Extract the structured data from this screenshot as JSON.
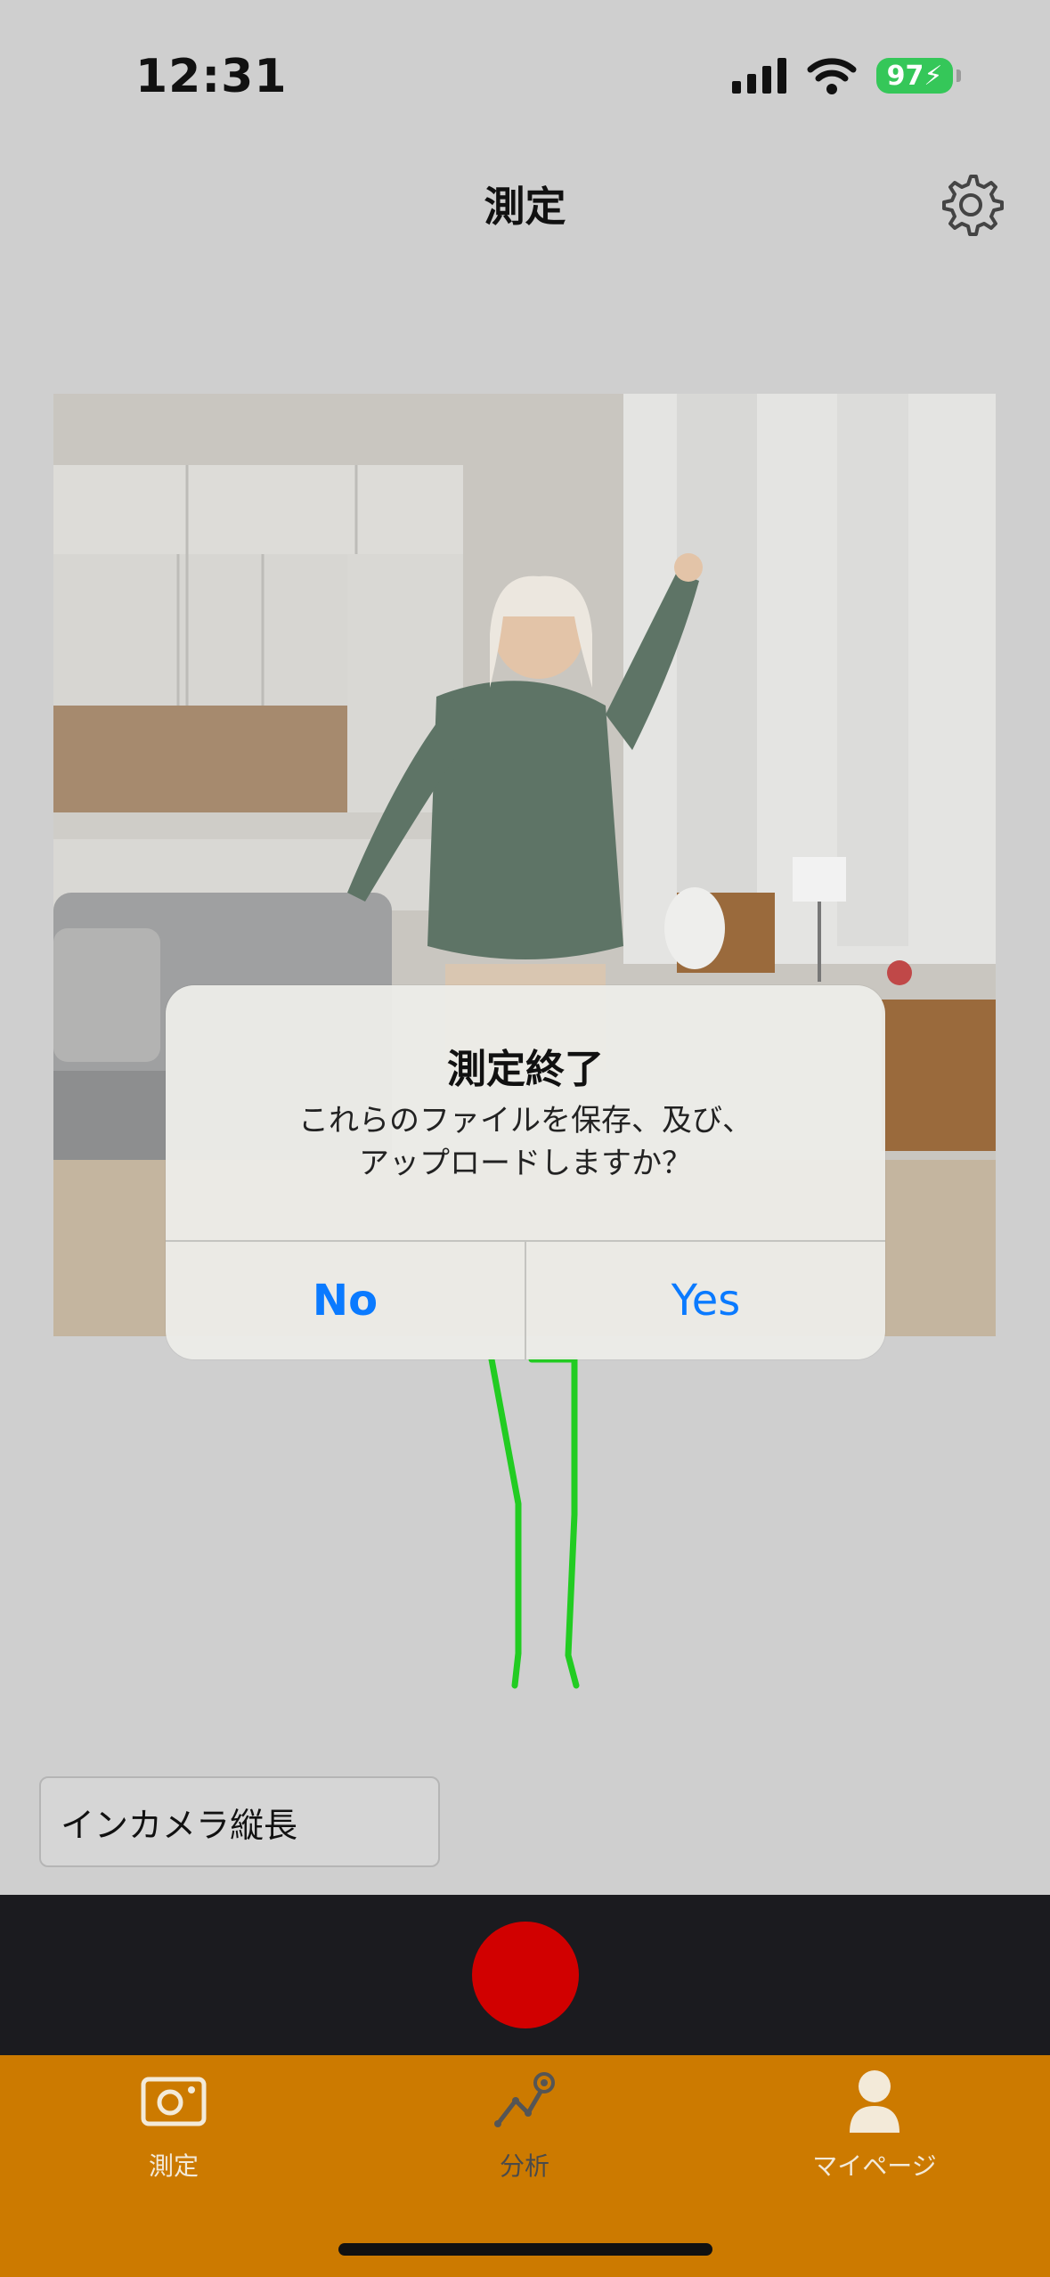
{
  "status_bar": {
    "time": "12:31",
    "battery": "97"
  },
  "header": {
    "title": "測定"
  },
  "dialog": {
    "title": "測定終了",
    "message": "これらのファイルを保存、及び、\nアップロードしますか？",
    "no_label": "No",
    "yes_label": "Yes"
  },
  "camera_select": {
    "value": "インカメラ縦長"
  },
  "tabs": [
    {
      "label": "測定",
      "icon": "camera-icon"
    },
    {
      "label": "分析",
      "icon": "analysis-icon"
    },
    {
      "label": "マイページ",
      "icon": "person-icon"
    }
  ],
  "colors": {
    "accent": "#cc7a00",
    "record": "#d10000",
    "dialog_button": "#0a7aff",
    "skeleton": "#22cc22",
    "battery": "#35c759"
  }
}
